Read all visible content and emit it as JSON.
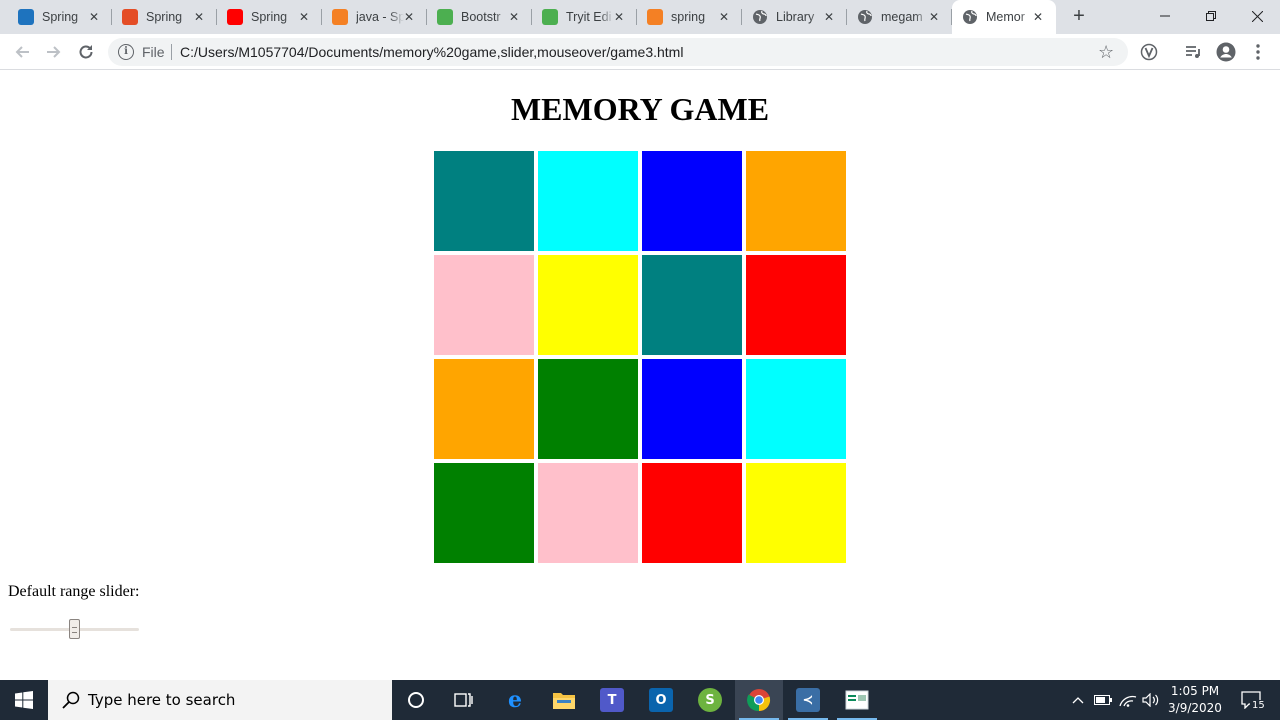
{
  "browser": {
    "tabs": [
      {
        "title": "Spring",
        "icon": "spring-favicon-icon",
        "color": "#1e73be"
      },
      {
        "title": "Spring",
        "icon": "javatpoint-favicon-icon",
        "color": "#e44d26"
      },
      {
        "title": "Spring",
        "icon": "youtube-favicon-icon",
        "color": "#ff0000"
      },
      {
        "title": "java - Sp",
        "icon": "stackoverflow-favicon-icon",
        "color": "#f48024"
      },
      {
        "title": "Bootstr",
        "icon": "w3schools-favicon-icon",
        "color": "#4caf50"
      },
      {
        "title": "Tryit Edi",
        "icon": "w3schools-favicon-icon",
        "color": "#4caf50"
      },
      {
        "title": "spring",
        "icon": "stackoverflow-favicon-icon",
        "color": "#f48024"
      },
      {
        "title": "Library",
        "icon": "globe-icon",
        "color": "#5f6368"
      },
      {
        "title": "megam",
        "icon": "globe-icon",
        "color": "#5f6368"
      },
      {
        "title": "Memor",
        "icon": "globe-icon",
        "color": "#5f6368",
        "active": true
      }
    ],
    "address": {
      "scheme_label": "File",
      "url": "C:/Users/M1057704/Documents/memory%20game,slider,mouseover/game3.html"
    }
  },
  "page": {
    "title": "MEMORY GAME",
    "tiles": [
      "#008080",
      "#00ffff",
      "#0000ff",
      "#ffa500",
      "#ffc0cb",
      "#ffff00",
      "#008080",
      "#ff0000",
      "#ffa500",
      "#008000",
      "#0000ff",
      "#00ffff",
      "#008000",
      "#ffc0cb",
      "#ff0000",
      "#ffff00"
    ],
    "slider": {
      "label": "Default range slider:",
      "value": 0.5
    }
  },
  "taskbar": {
    "search_placeholder": "Type here to search",
    "time": "1:05 PM",
    "date": "3/9/2020",
    "notification_count": "15"
  }
}
